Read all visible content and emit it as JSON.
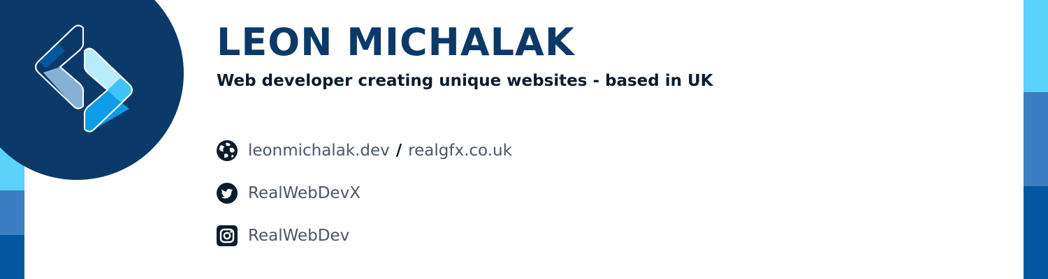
{
  "profile": {
    "name": "LEON MICHALAK",
    "tagline": "Web developer creating unique websites - based in UK"
  },
  "contacts": {
    "website_primary": "leonmichalak.dev",
    "separator": "/",
    "website_secondary": "realgfx.co.uk",
    "twitter_handle": "RealWebDevX",
    "instagram_handle": "RealWebDev"
  },
  "icons": {
    "website": "globe-icon",
    "twitter": "twitter-bird-icon",
    "instagram": "instagram-camera-icon",
    "logo": "chevron-brackets-logo"
  },
  "colors": {
    "navy": "#0b3a68",
    "text_dark": "#0c1c2c",
    "text_muted": "#4a5568",
    "stripe_light": "#5ad2fb",
    "stripe_mid": "#3a7fc1",
    "stripe_dark": "#03579e",
    "logo_light": "#b8ecfd",
    "logo_cyan": "#40c4f8",
    "logo_blue": "#0f9be6",
    "logo_pale": "#86b0d6"
  }
}
